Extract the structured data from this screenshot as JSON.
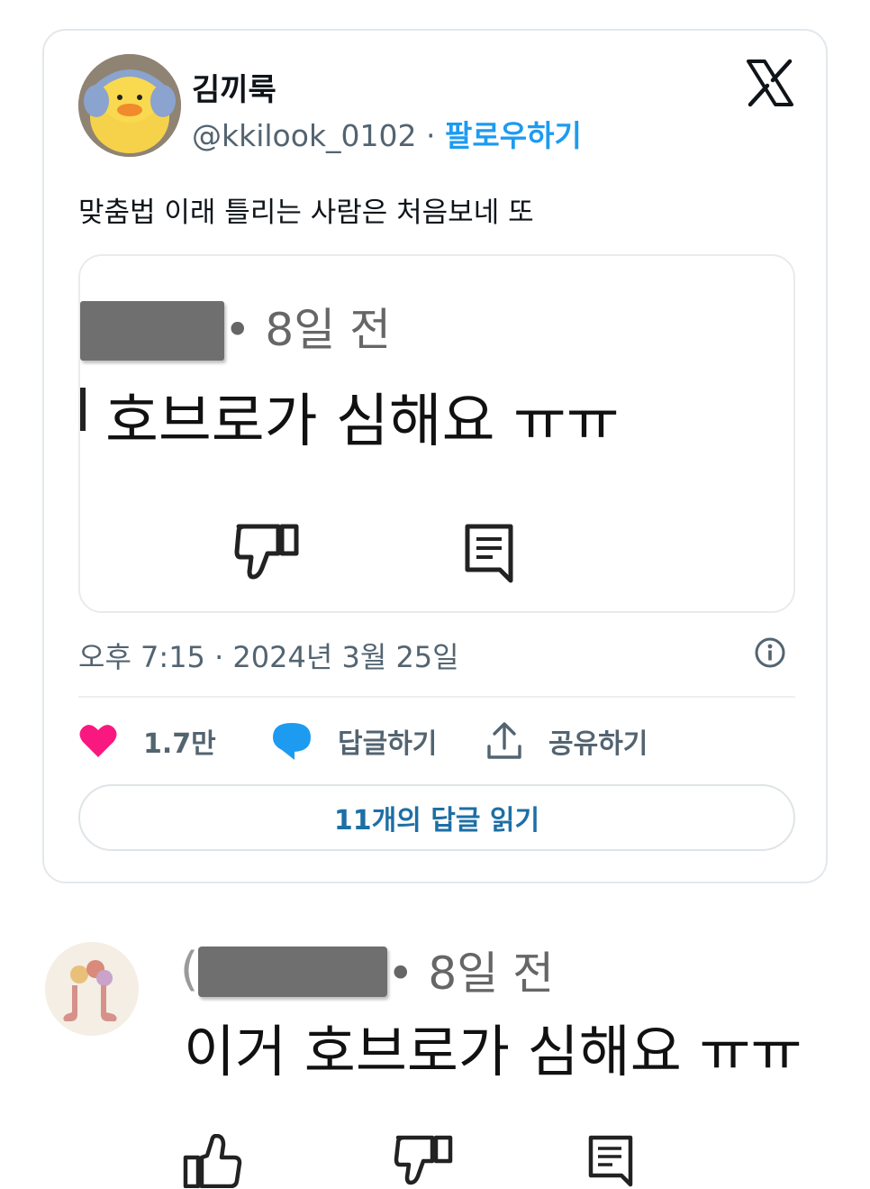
{
  "tweet": {
    "author_name": "김끼룩",
    "handle": "@kkilook_0102",
    "separator": " · ",
    "follow_label": "팔로우하기",
    "text": "맞춤법 이래 틀리는 사람은 처음보네 또",
    "timestamp": "오후 7:15 · 2024년 3월 25일",
    "like_count": "1.7만",
    "reply_label": "답글하기",
    "share_label": "공유하기",
    "read_replies_label": "11개의 답글 읽기",
    "colors": {
      "follow": "#1d9bf0",
      "heart": "#f91880",
      "reply": "#1d9bf0"
    }
  },
  "quoted": {
    "meta": "• 8일 전",
    "text": "호브로가 심해요 ㅠㅠ"
  },
  "comment": {
    "paren": "(",
    "meta": "• 8일 전",
    "text": "이거 호브로가 심해요 ㅠㅠ"
  },
  "icons": [
    "x-logo-icon",
    "info-icon",
    "heart-icon",
    "reply-icon",
    "share-icon",
    "dislike-icon",
    "comment-icon",
    "like-icon"
  ]
}
